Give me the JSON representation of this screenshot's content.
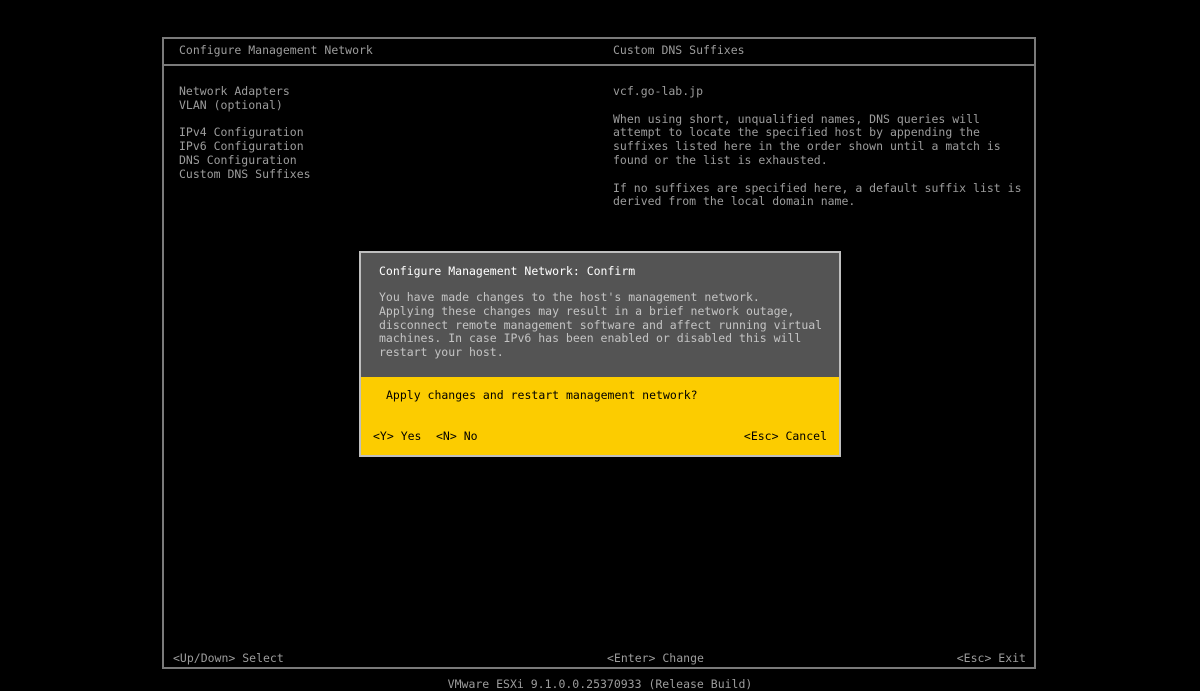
{
  "left_pane": {
    "title": "Configure Management Network",
    "menu": [
      "Network Adapters",
      "VLAN (optional)",
      "IPv4 Configuration",
      "IPv6 Configuration",
      "DNS Configuration",
      "Custom DNS Suffixes"
    ]
  },
  "right_pane": {
    "title": "Custom DNS Suffixes",
    "value": "vcf.go-lab.jp",
    "description_1": "When using short, unqualified names, DNS queries will\nattempt to locate the specified host by appending the\nsuffixes listed here in the order shown until a match is\nfound or the list is exhausted.",
    "description_2": "If no suffixes are specified here, a default suffix list is\nderived from the local domain name."
  },
  "dialog": {
    "title": "Configure Management Network: Confirm",
    "body": "You have made changes to the host's management network.\nApplying these changes may result in a brief network outage,\ndisconnect remote management software and affect running virtual\nmachines. In case IPv6 has been enabled or disabled this will\nrestart your host.",
    "question": "Apply changes and restart management network?",
    "yes_label": "<Y> Yes",
    "no_label": "<N> No",
    "cancel_label": "<Esc> Cancel"
  },
  "footer": {
    "left": "<Up/Down> Select",
    "center": "<Enter> Change",
    "right": "<Esc> Exit"
  },
  "version": "VMware ESXi 9.1.0.0.25370933 (Release Build)",
  "colors": {
    "background": "#000000",
    "text": "#9c9c9c",
    "dialog_bg": "#545454",
    "action_bar": "#fccc00"
  }
}
